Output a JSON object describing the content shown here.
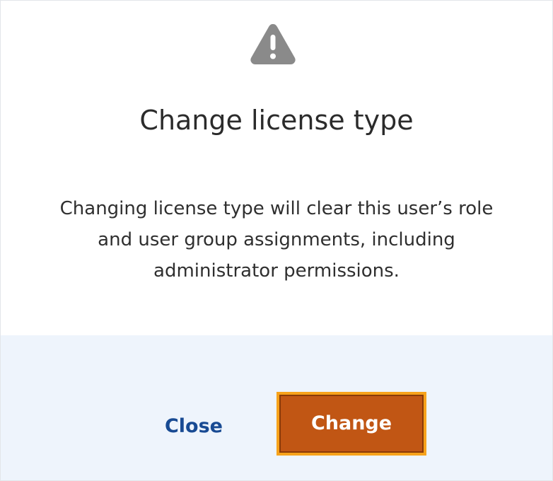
{
  "dialog": {
    "title": "Change license type",
    "message": "Changing license type will clear this user’s role and user group assignments, including administrator permissions.",
    "icon": "warning-icon"
  },
  "footer": {
    "close_label": "Close",
    "change_label": "Change"
  },
  "colors": {
    "accent_button": "#c15614",
    "focus_ring": "#f7a21b",
    "link": "#184a93",
    "footer_bg": "#eef4fc",
    "icon": "#8a8a8a"
  }
}
